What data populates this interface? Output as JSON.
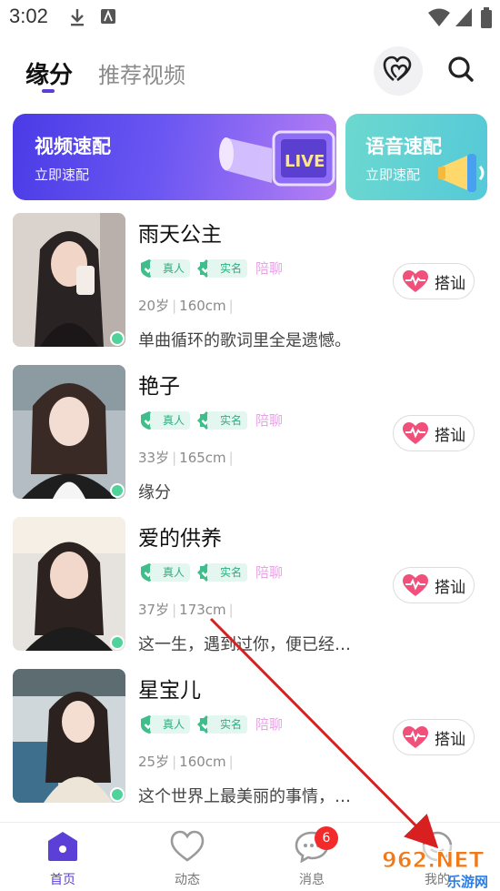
{
  "status_bar": {
    "time": "3:02"
  },
  "header": {
    "tabs": [
      {
        "label": "缘分",
        "active": true
      },
      {
        "label": "推荐视频",
        "active": false
      }
    ]
  },
  "banners": {
    "video": {
      "title": "视频速配",
      "subtitle": "立即速配",
      "badge": "LIVE"
    },
    "voice": {
      "title": "语音速配",
      "subtitle": "立即速配"
    }
  },
  "users": [
    {
      "name": "雨天公主",
      "tag_real": "真人",
      "tag_verified": "实名",
      "tag_chat": "陪聊",
      "age": "20岁",
      "height": "160cm",
      "bio": "单曲循环的歌词里全是遗憾。",
      "button": "搭讪"
    },
    {
      "name": "艳子",
      "tag_real": "真人",
      "tag_verified": "实名",
      "tag_chat": "陪聊",
      "age": "33岁",
      "height": "165cm",
      "bio": "缘分",
      "button": "搭讪"
    },
    {
      "name": "爱的供养",
      "tag_real": "真人",
      "tag_verified": "实名",
      "tag_chat": "陪聊",
      "age": "37岁",
      "height": "173cm",
      "bio": "这一生，遇到过你，便已经…",
      "button": "搭讪"
    },
    {
      "name": "星宝儿",
      "tag_real": "真人",
      "tag_verified": "实名",
      "tag_chat": "陪聊",
      "age": "25岁",
      "height": "160cm",
      "bio": "这个世界上最美丽的事情，…",
      "button": "搭讪"
    }
  ],
  "bottom_nav": {
    "items": [
      {
        "label": "首页",
        "active": true
      },
      {
        "label": "动态",
        "active": false
      },
      {
        "label": "消息",
        "active": false,
        "badge": "6"
      },
      {
        "label": "我的",
        "active": false
      }
    ]
  },
  "watermark": {
    "text_top": "962.NET",
    "text_bottom": "乐游网"
  },
  "colors": {
    "accent": "#5b3fd6",
    "tag_green": "#2fae7f",
    "online": "#4fd39b",
    "heart": "#f0507a",
    "arrow": "#d82020"
  }
}
